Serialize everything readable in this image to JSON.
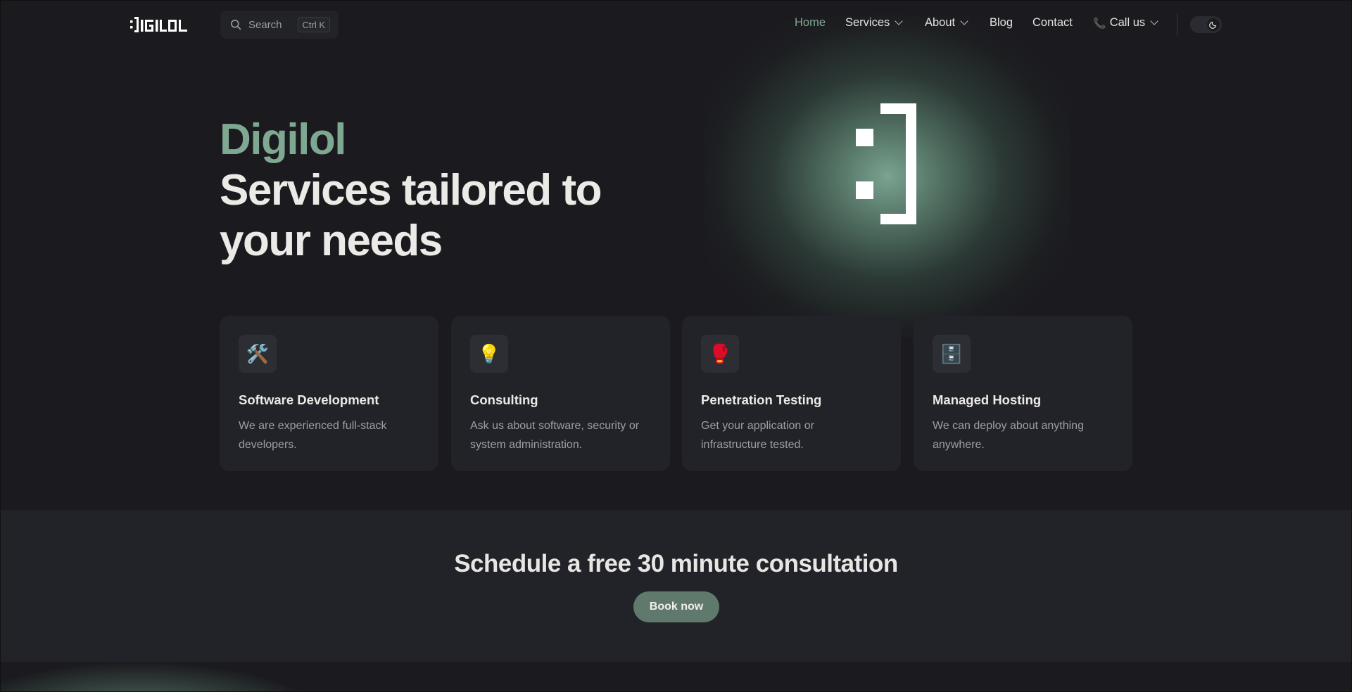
{
  "brand": {
    "logo_text": "DIGILOL"
  },
  "search": {
    "placeholder": "Search",
    "shortcut": "Ctrl K"
  },
  "nav": {
    "items": [
      {
        "label": "Home",
        "active": true
      },
      {
        "label": "Services",
        "dropdown": true
      },
      {
        "label": "About",
        "dropdown": true
      },
      {
        "label": "Blog"
      },
      {
        "label": "Contact"
      },
      {
        "label": "Call us",
        "dropdown": true,
        "icon": "phone-icon"
      }
    ],
    "theme_toggle": {
      "icon": "moon-icon",
      "mode": "dark"
    }
  },
  "hero": {
    "brand": "Digilol",
    "title": "Services tailored to your needs",
    "mark_icon": "smiley-bracket-icon"
  },
  "services": [
    {
      "icon": "🛠️",
      "icon_name": "tools-icon",
      "title": "Software Development",
      "description": "We are experienced full-stack developers."
    },
    {
      "icon": "💡",
      "icon_name": "lightbulb-icon",
      "title": "Consulting",
      "description": "Ask us about software, security or system administration."
    },
    {
      "icon": "🥊",
      "icon_name": "boxing-glove-icon",
      "title": "Penetration Testing",
      "description": "Get your application or infrastructure tested."
    },
    {
      "icon": "🗄️",
      "icon_name": "file-cabinet-icon",
      "title": "Managed Hosting",
      "description": "We can deploy about anything anywhere."
    }
  ],
  "cta": {
    "title": "Schedule a free 30 minute consultation",
    "button": "Book now"
  },
  "colors": {
    "accent": "#7fa892",
    "background": "#1b1b1f",
    "card": "#222328",
    "button": "#5f7a6c"
  }
}
